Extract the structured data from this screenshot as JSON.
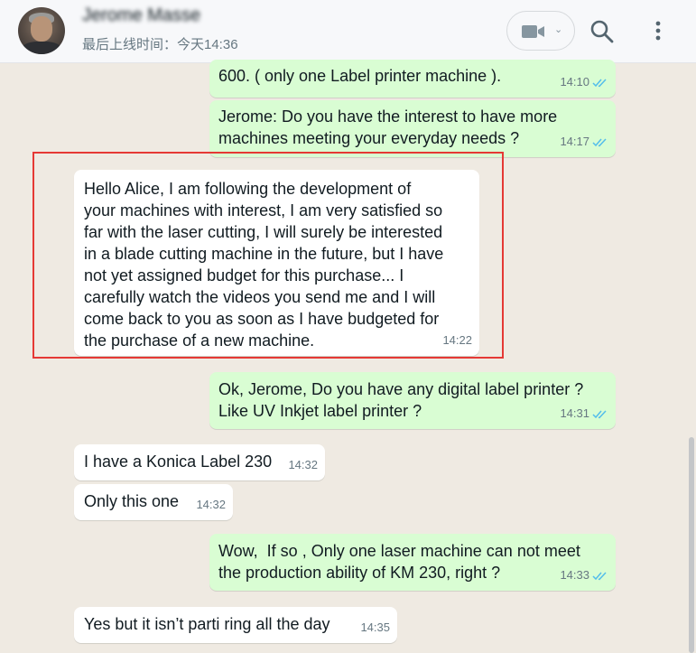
{
  "header": {
    "contact_name": "Jerome Masse",
    "last_seen": "最后上线时间：今天14:36"
  },
  "icons": {
    "video": "video-camera-icon",
    "chevron": "chevron-down-icon",
    "search": "search-icon",
    "menu": "more-vertical-icon",
    "tick": "double-check-icon"
  },
  "colors": {
    "outgoing_bubble": "#d9fdd3",
    "incoming_bubble": "#ffffff",
    "read_tick": "#53bdeb",
    "highlight_border": "#e53935"
  },
  "messages": [
    {
      "dir": "out",
      "text": "600. ( only one Label printer machine ).",
      "time": "14:10",
      "read": true
    },
    {
      "dir": "out",
      "text": "Jerome: Do you have the interest to have more\nmachines meeting your everyday needs ?",
      "time": "14:17",
      "read": true
    },
    {
      "dir": "in",
      "text": "Hello Alice, I am following the development of\nyour machines with interest, I am very satisfied so\nfar with the laser cutting, I will surely be interested\nin a blade cutting machine in the future, but I have\nnot yet assigned budget for this purchase... I\ncarefully watch the videos you send me and I will\ncome back to you as soon as I have budgeted for\nthe purchase of a new machine.",
      "time": "14:22",
      "highlighted": true
    },
    {
      "dir": "out",
      "text": "Ok, Jerome, Do you have any digital label printer ?\nLike UV Inkjet label printer ?",
      "time": "14:31",
      "read": true
    },
    {
      "dir": "in",
      "text": "I have a Konica Label 230",
      "time": "14:32"
    },
    {
      "dir": "in",
      "text": "Only this one",
      "time": "14:32"
    },
    {
      "dir": "out",
      "text": "Wow,  If so , Only one laser machine can not meet\nthe production ability of KM 230, right ?",
      "time": "14:33",
      "read": true
    },
    {
      "dir": "in",
      "text": "Yes but it isn’t parti ring all the day",
      "time": "14:35"
    }
  ]
}
